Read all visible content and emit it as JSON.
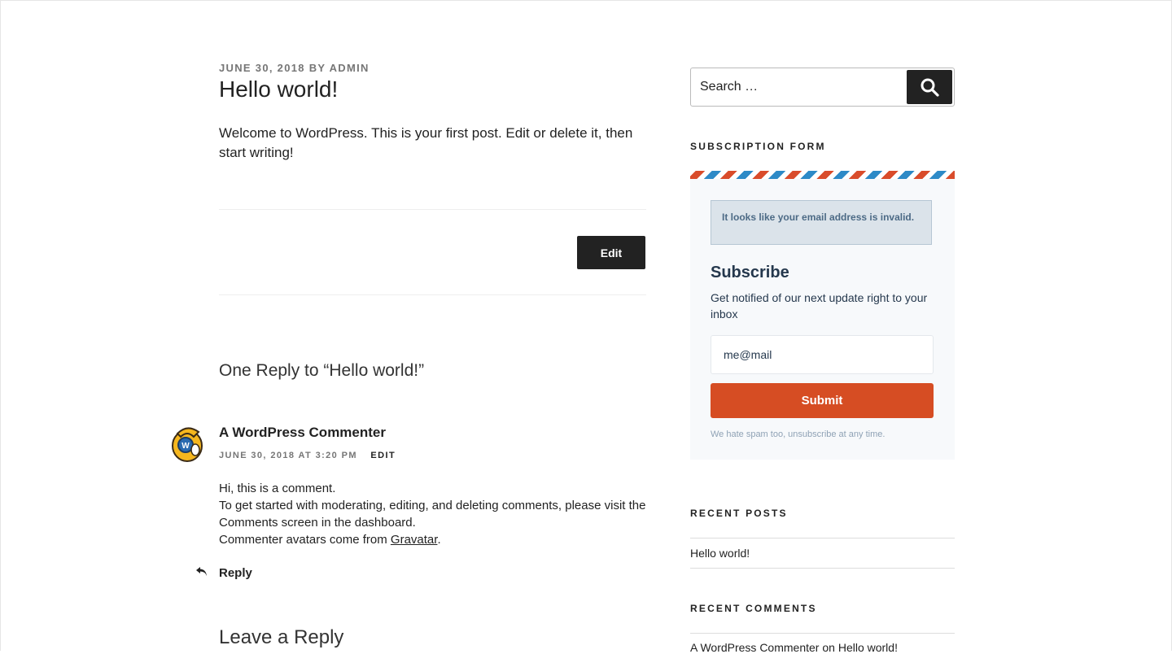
{
  "post": {
    "date": "JUNE 30, 2018",
    "by": "BY",
    "author": "ADMIN",
    "title": "Hello world!",
    "content": "Welcome to WordPress. This is your first post. Edit or delete it, then start writing!",
    "edit_label": "Edit"
  },
  "comments": {
    "heading": "One Reply to “Hello world!”",
    "items": [
      {
        "author": "A WordPress Commenter",
        "date": "JUNE 30, 2018 AT 3:20 PM",
        "edit_label": "EDIT",
        "lines": [
          "Hi, this is a comment.",
          "To get started with moderating, editing, and deleting comments, please visit the Comments screen in the dashboard.",
          "Commenter avatars come from "
        ],
        "link_text": "Gravatar",
        "link_suffix": ".",
        "reply_label": "Reply"
      }
    ],
    "leave_reply": "Leave a Reply"
  },
  "sidebar": {
    "search": {
      "placeholder": "Search …"
    },
    "subscription": {
      "widget_title": "SUBSCRIPTION FORM",
      "alert": "It looks like your email address is invalid.",
      "title": "Subscribe",
      "description": "Get notified of our next update right to your inbox",
      "email_value": "me@mail",
      "submit_label": "Submit",
      "note": "We hate spam too, unsubscribe at any time."
    },
    "recent_posts": {
      "title": "RECENT POSTS",
      "items": [
        "Hello world!"
      ]
    },
    "recent_comments": {
      "title": "RECENT COMMENTS",
      "items": [
        {
          "author": "A WordPress Commenter",
          "on": "on",
          "post": "Hello world!"
        }
      ]
    }
  },
  "colors": {
    "text": "#222222",
    "muted": "#767676",
    "submit": "#d64d23",
    "alert_bg": "#dbe3ea"
  }
}
